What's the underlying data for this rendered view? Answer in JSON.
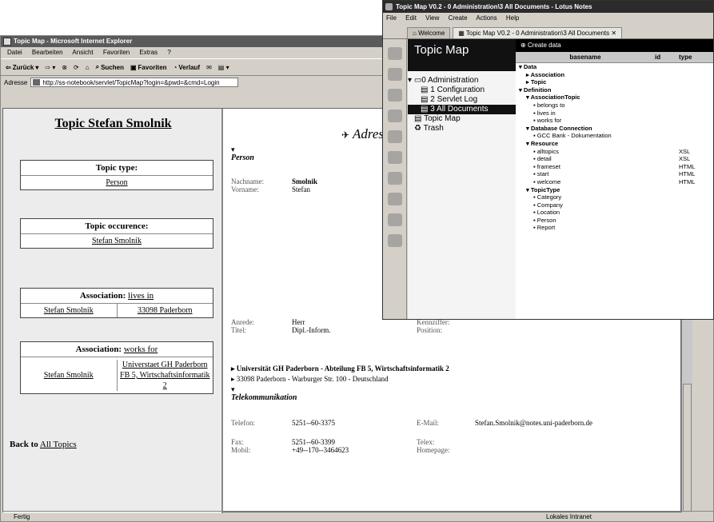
{
  "ie": {
    "title": "Topic Map - Microsoft Internet Explorer",
    "menu": [
      "Datei",
      "Bearbeiten",
      "Ansicht",
      "Favoriten",
      "Extras",
      "?"
    ],
    "toolbar": [
      "Zurück",
      "Suchen",
      "Favoriten",
      "Verlauf"
    ],
    "address_label": "Adresse",
    "address": "http://ss-notebook/servlet/TopicMap?login=&pwd=&cmd=Login",
    "status": "Fertig",
    "status_zone": "Lokales Intranet"
  },
  "left": {
    "title": "Topic Stefan Smolnik",
    "topic_type_header": "Topic type:",
    "topic_type": "Person",
    "occurence_header": "Topic occurence:",
    "occurence": "Stefan Smolnik",
    "assoc1_header": "Association:",
    "assoc1_link": "lives in",
    "assoc1_a": "Stefan Smolnik",
    "assoc1_b": "33098 Paderborn",
    "assoc2_header": "Association:",
    "assoc2_link": "works for",
    "assoc2_a": "Stefan Smolnik",
    "assoc2_b": "Universtaet GH Paderborn FB 5, Wirtschaftsinformatik 2",
    "back_prefix": "Back to",
    "back_link": "All Topics"
  },
  "right": {
    "adres": "Adres",
    "section_person": "Person",
    "nachname_label": "Nachname:",
    "nachname": "Smolnik",
    "vorname_label": "Vorname:",
    "vorname": "Stefan",
    "anrede_label": "Anrede:",
    "anrede": "Herr",
    "titel_label": "Titel:",
    "titel": "Dipl.-Inform.",
    "kennziffer_label": "Kennziffer:",
    "position_label": "Position:",
    "org": "Universität GH Paderborn - Abteilung FB 5, Wirtschaftsinformatik 2",
    "address": "33098 Paderborn - Warburger Str. 100 - Deutschland",
    "section_tele": "Telekommunikation",
    "telefon_label": "Telefon:",
    "telefon": "5251--60-3375",
    "email_label": "E-Mail:",
    "email": "Stefan.Smolnik@notes.uni-paderborn.de",
    "fax_label": "Fax:",
    "fax": "5251--60-3399",
    "telex_label": "Telex:",
    "mobil_label": "Mobil:",
    "mobil": "+49--170--3464623",
    "homepage_label": "Homepage:"
  },
  "lotus": {
    "title": "Topic Map V0.2 - 0 Administration\\3 All Documents - Lotus Notes",
    "menu": [
      "File",
      "Edit",
      "View",
      "Create",
      "Actions",
      "Help"
    ],
    "tab1": "Welcome",
    "tab2": "Topic Map V0.2 - 0 Administration\\3 All Documents",
    "nav_title": "Topic Map",
    "tree": [
      "0 Administration",
      "1 Configuration",
      "2 Servlet Log",
      "3 All Documents",
      "Topic Map",
      "Trash"
    ],
    "action": "Create data",
    "col_basename": "basename",
    "col_id": "id",
    "col_type": "type",
    "rows": [
      {
        "name": "Data",
        "type": "",
        "bold": true,
        "indent": 0
      },
      {
        "name": "Association",
        "type": "",
        "bold": true,
        "indent": 1
      },
      {
        "name": "Topic",
        "type": "",
        "bold": true,
        "indent": 1
      },
      {
        "name": "Definition",
        "type": "",
        "bold": true,
        "indent": 0
      },
      {
        "name": "AssociationTopic",
        "type": "",
        "bold": true,
        "indent": 1
      },
      {
        "name": "belongs to",
        "type": "",
        "bold": false,
        "indent": 2
      },
      {
        "name": "lives in",
        "type": "",
        "bold": false,
        "indent": 2
      },
      {
        "name": "works for",
        "type": "",
        "bold": false,
        "indent": 2
      },
      {
        "name": "Database Connection",
        "type": "",
        "bold": true,
        "indent": 1
      },
      {
        "name": "GCC Bank - Dokumentation",
        "type": "",
        "bold": false,
        "indent": 2
      },
      {
        "name": "Resource",
        "type": "",
        "bold": true,
        "indent": 1
      },
      {
        "name": "alltopics",
        "type": "XSL",
        "bold": false,
        "indent": 2
      },
      {
        "name": "detail",
        "type": "XSL",
        "bold": false,
        "indent": 2
      },
      {
        "name": "frameset",
        "type": "HTML",
        "bold": false,
        "indent": 2
      },
      {
        "name": "start",
        "type": "HTML",
        "bold": false,
        "indent": 2
      },
      {
        "name": "welcome",
        "type": "HTML",
        "bold": false,
        "indent": 2
      },
      {
        "name": "TopicType",
        "type": "",
        "bold": true,
        "indent": 1
      },
      {
        "name": "Category",
        "type": "",
        "bold": false,
        "indent": 2
      },
      {
        "name": "Company",
        "type": "",
        "bold": false,
        "indent": 2
      },
      {
        "name": "Location",
        "type": "",
        "bold": false,
        "indent": 2
      },
      {
        "name": "Person",
        "type": "",
        "bold": false,
        "indent": 2
      },
      {
        "name": "Report",
        "type": "",
        "bold": false,
        "indent": 2
      }
    ]
  }
}
